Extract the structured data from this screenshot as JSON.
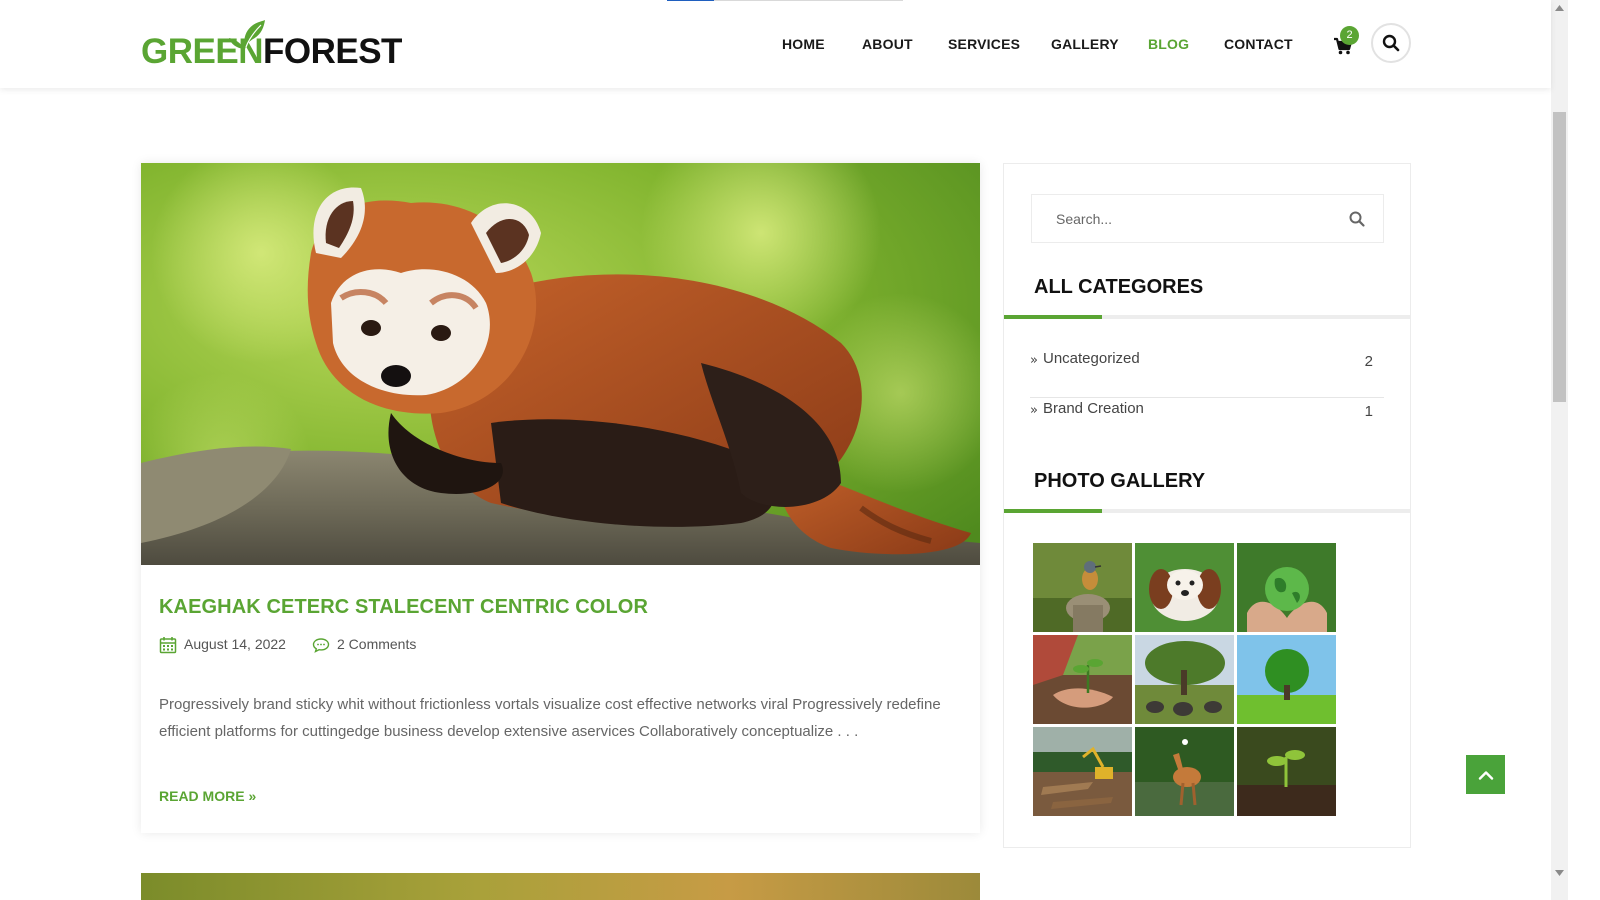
{
  "header": {
    "logo": {
      "part1": "GREEN",
      "part2": "FOREST"
    },
    "nav": [
      {
        "label": "HOME",
        "active": false
      },
      {
        "label": "ABOUT",
        "active": false
      },
      {
        "label": "SERVICES",
        "active": false
      },
      {
        "label": "GALLERY",
        "active": false
      },
      {
        "label": "BLOG",
        "active": true
      },
      {
        "label": "CONTACT",
        "active": false
      }
    ],
    "cart_count": "2",
    "cart_icon": "shopping-cart-icon",
    "search_icon": "search-icon"
  },
  "post": {
    "image_subject": "red panda lying on a tree branch",
    "title": "KAEGHAK CETERC STALECENT CENTRIC COLOR",
    "date": "August 14, 2022",
    "comments": "2 Comments",
    "excerpt": "Progressively brand sticky whit without frictionless vortals visualize cost effective networks viral Progressively redefine efficient platforms for cuttingedge business develop extensive aservices Collaboratively conceptualize . . .",
    "read_more": "READ MORE »"
  },
  "sidebar": {
    "search_placeholder": "Search...",
    "categories_title": "ALL CATEGORES",
    "categories": [
      {
        "label": "Uncategorized",
        "count": "2"
      },
      {
        "label": "Brand Creation",
        "count": "1"
      }
    ],
    "gallery_title": "PHOTO GALLERY",
    "gallery": [
      "bird on stump",
      "puppy on grass",
      "hands holding globe",
      "planting seedling",
      "elephants under tree",
      "tree on meadow",
      "deforestation excavator",
      "fawn in stream",
      "sprout in soil"
    ]
  },
  "colors": {
    "accent_green": "#5aa533",
    "scroll_up": "#4aa33a"
  }
}
